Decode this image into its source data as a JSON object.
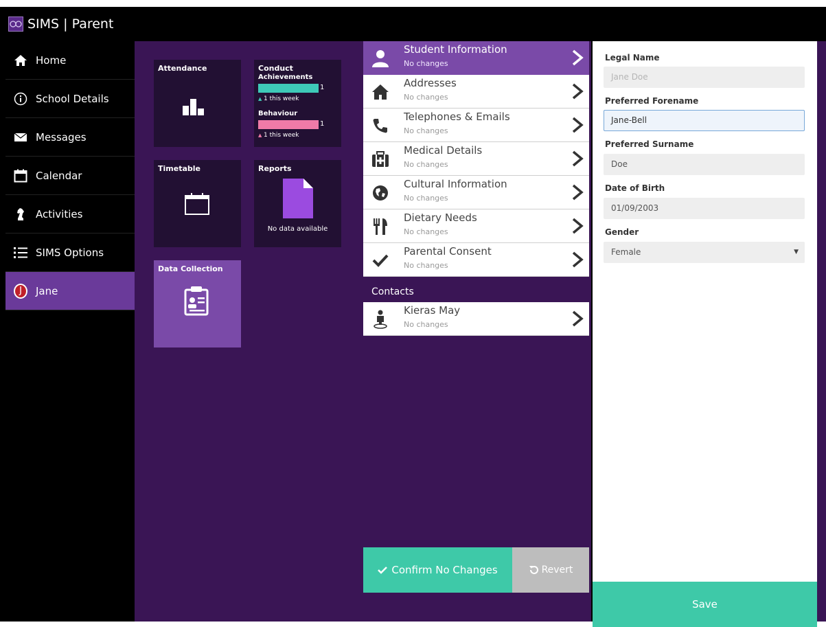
{
  "app": {
    "title": "SIMS | Parent",
    "logo_icon": "sims-logo-icon"
  },
  "sidebar": {
    "items": [
      {
        "label": "Home",
        "icon": "home-icon"
      },
      {
        "label": "School Details",
        "icon": "info-icon"
      },
      {
        "label": "Messages",
        "icon": "envelope-icon"
      },
      {
        "label": "Calendar",
        "icon": "calendar-icon"
      },
      {
        "label": "Activities",
        "icon": "chess-knight-icon"
      },
      {
        "label": "SIMS Options",
        "icon": "list-icon"
      }
    ],
    "user": {
      "initial": "J",
      "label": "Jane",
      "avatar_color": "#c0202a"
    }
  },
  "tiles": {
    "attendance": {
      "title": "Attendance",
      "icon": "bar-chart-icon"
    },
    "conduct": {
      "title": "Conduct",
      "achievements_label": "Achievements",
      "achievements_count": "1",
      "achievements_week": "1 this week",
      "achievements_color": "#3ec9b8",
      "behaviour_label": "Behaviour",
      "behaviour_count": "1",
      "behaviour_week": "1 this week",
      "behaviour_color": "#f07aa8"
    },
    "timetable": {
      "title": "Timetable",
      "icon": "calendar-icon"
    },
    "reports": {
      "title": "Reports",
      "icon": "document-icon",
      "empty_text": "No data available",
      "doc_color": "#9b4be0"
    },
    "data_collection": {
      "title": "Data Collection",
      "icon": "clipboard-icon"
    }
  },
  "list": {
    "items": [
      {
        "title": "Student Information",
        "subtitle": "No changes",
        "icon": "user-icon",
        "selected": true
      },
      {
        "title": "Addresses",
        "subtitle": "No changes",
        "icon": "house-icon"
      },
      {
        "title": "Telephones & Emails",
        "subtitle": "No changes",
        "icon": "phone-icon"
      },
      {
        "title": "Medical Details",
        "subtitle": "No changes",
        "icon": "medical-kit-icon"
      },
      {
        "title": "Cultural Information",
        "subtitle": "No changes",
        "icon": "globe-icon"
      },
      {
        "title": "Dietary Needs",
        "subtitle": "No changes",
        "icon": "cutlery-icon"
      },
      {
        "title": "Parental Consent",
        "subtitle": "No changes",
        "icon": "checkmark-icon"
      }
    ],
    "contacts_header": "Contacts",
    "contacts": [
      {
        "title": "Kieras May",
        "subtitle": "No changes",
        "icon": "person-pin-icon"
      }
    ],
    "confirm_label": "Confirm No Changes",
    "revert_label": "Revert"
  },
  "form": {
    "legal_name_label": "Legal Name",
    "legal_name_value": "Jane Doe",
    "preferred_forename_label": "Preferred Forename",
    "preferred_forename_value": "Jane-Bell",
    "preferred_surname_label": "Preferred Surname",
    "preferred_surname_value": "Doe",
    "dob_label": "Date of Birth",
    "dob_value": "01/09/2003",
    "gender_label": "Gender",
    "gender_value": "Female",
    "save_label": "Save"
  },
  "colors": {
    "purple_dark": "#3a1555",
    "purple_tile": "#221033",
    "purple_selected": "#7a4aa8",
    "teal": "#3ec9a8"
  }
}
